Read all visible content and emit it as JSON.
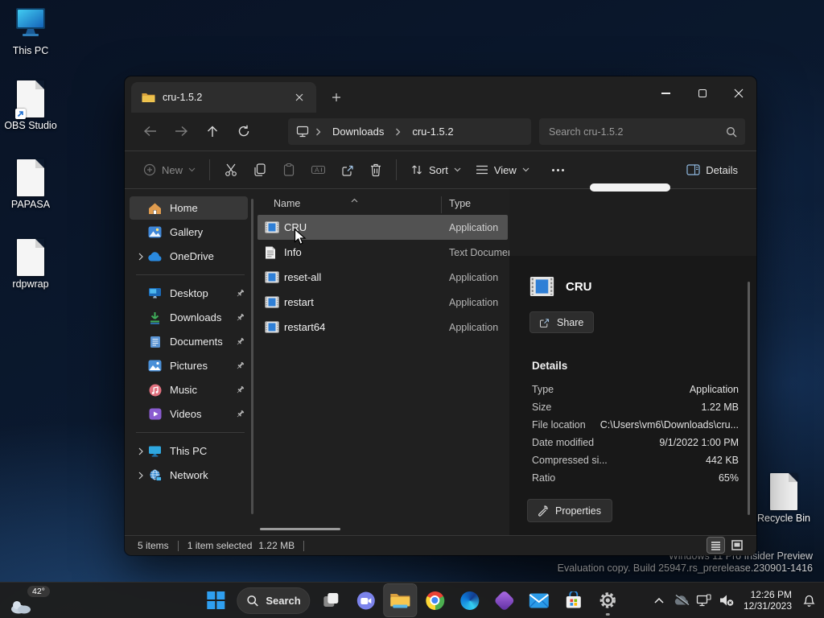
{
  "desktop": {
    "icons": [
      {
        "label": "This PC"
      },
      {
        "label": "OBS Studio"
      },
      {
        "label": "PAPASA"
      },
      {
        "label": "rdpwrap"
      },
      {
        "label": "Recycle Bin"
      }
    ],
    "watermark": {
      "line1": "Windows 11 Pro Insider Preview",
      "line2": "Evaluation copy. Build 25947.rs_prerelease.230901-1416"
    }
  },
  "window": {
    "tab_title": "cru-1.5.2",
    "nav": {
      "breadcrumb": [
        "Downloads",
        "cru-1.5.2"
      ],
      "search_placeholder": "Search cru-1.5.2"
    },
    "toolbar": {
      "new_label": "New",
      "sort_label": "Sort",
      "view_label": "View",
      "details_label": "Details"
    },
    "sidebar": {
      "items": [
        {
          "label": "Home"
        },
        {
          "label": "Gallery"
        },
        {
          "label": "OneDrive"
        },
        {
          "label": "Desktop"
        },
        {
          "label": "Downloads"
        },
        {
          "label": "Documents"
        },
        {
          "label": "Pictures"
        },
        {
          "label": "Music"
        },
        {
          "label": "Videos"
        },
        {
          "label": "This PC"
        },
        {
          "label": "Network"
        }
      ]
    },
    "filelist": {
      "columns": [
        "Name",
        "Type"
      ],
      "rows": [
        {
          "name": "CRU",
          "type": "Application"
        },
        {
          "name": "Info",
          "type": "Text Document"
        },
        {
          "name": "reset-all",
          "type": "Application"
        },
        {
          "name": "restart",
          "type": "Application"
        },
        {
          "name": "restart64",
          "type": "Application"
        }
      ]
    },
    "details": {
      "file_name": "CRU",
      "share_label": "Share",
      "heading": "Details",
      "rows": [
        {
          "label": "Type",
          "value": "Application"
        },
        {
          "label": "Size",
          "value": "1.22 MB"
        },
        {
          "label": "File location",
          "value": "C:\\Users\\vm6\\Downloads\\cru..."
        },
        {
          "label": "Date modified",
          "value": "9/1/2022 1:00 PM"
        },
        {
          "label": "Compressed si...",
          "value": "442 KB"
        },
        {
          "label": "Ratio",
          "value": "65%"
        }
      ],
      "properties_label": "Properties"
    },
    "statusbar": {
      "count": "5 items",
      "selected": "1 item selected",
      "size": "1.22 MB"
    }
  },
  "taskbar": {
    "weather": "42°",
    "search_label": "Search",
    "clock_time": "12:26 PM",
    "clock_date": "12/31/2023"
  }
}
